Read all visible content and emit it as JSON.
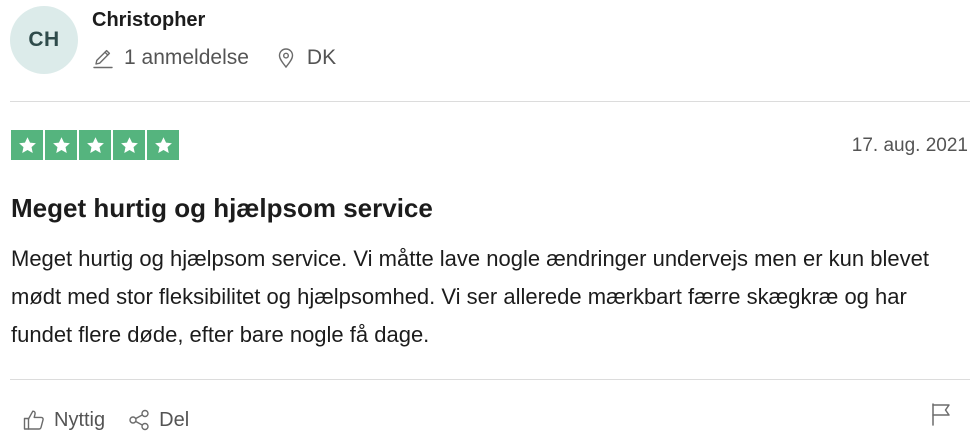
{
  "reviewer": {
    "initials": "CH",
    "name": "Christopher",
    "review_count": "1 anmeldelse",
    "country": "DK"
  },
  "review": {
    "rating": 5,
    "star_color": "#55b47e",
    "date": "17. aug. 2021",
    "title": "Meget hurtig og hjælpsom service",
    "body": "Meget hurtig og hjælpsom service. Vi måtte lave nogle ændringer undervejs men er kun blevet mødt med stor fleksibilitet og hjælpsomhed. Vi ser allerede mærkbart færre skægkræ og har fundet flere døde, efter bare nogle få dage."
  },
  "actions": {
    "useful_label": "Nyttig",
    "share_label": "Del"
  },
  "icons": {
    "review_count": "pencil-icon",
    "country": "location-pin-icon",
    "useful": "thumbs-up-icon",
    "share": "share-icon",
    "report": "flag-icon"
  }
}
